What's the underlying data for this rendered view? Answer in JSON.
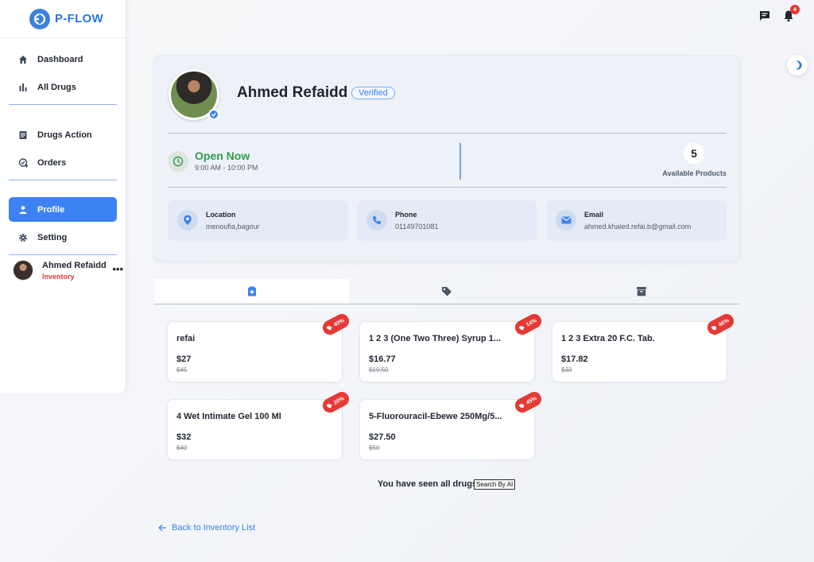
{
  "brand": {
    "name": "P-FLOW"
  },
  "sidebar": {
    "items": [
      {
        "label": "Dashboard",
        "icon": "home-icon"
      },
      {
        "label": "All Drugs",
        "icon": "bar-chart-icon"
      },
      {
        "label": "Drugs Action",
        "icon": "document-icon"
      },
      {
        "label": "Orders",
        "icon": "add-order-icon"
      },
      {
        "label": "Profile",
        "icon": "person-icon",
        "active": true
      },
      {
        "label": "Setting",
        "icon": "gear-icon"
      }
    ],
    "user": {
      "name": "Ahmed Refaidd",
      "role": "Inventory"
    }
  },
  "topbar": {
    "notification_count": "4"
  },
  "profile": {
    "name": "Ahmed Refaidd",
    "verified_label": "Verified",
    "status": "Open Now",
    "hours": "9:00 AM - 10:00 PM",
    "available_count": "5",
    "available_label": "Available Products",
    "location": {
      "title": "Location",
      "value": "menoufia,bagour"
    },
    "phone": {
      "title": "Phone",
      "value": "01149701081"
    },
    "email": {
      "title": "Email",
      "value": "ahmed.khaled.refai.b@gmail.com"
    }
  },
  "tabs": [
    {
      "icon": "medical-box-icon",
      "active": true
    },
    {
      "icon": "tag-icon"
    },
    {
      "icon": "archive-icon"
    }
  ],
  "products": [
    {
      "name": "refai",
      "price": "$27",
      "old_price": "$45",
      "discount": "40%"
    },
    {
      "name": "1 2 3 (One Two Three) Syrup 1...",
      "price": "$16.77",
      "old_price": "$19.50",
      "discount": "14%"
    },
    {
      "name": "1 2 3 Extra 20 F.C. Tab.",
      "price": "$17.82",
      "old_price": "$33",
      "discount": "46%"
    },
    {
      "name": "4 Wet Intimate Gel 100 Ml",
      "price": "$32",
      "old_price": "$40",
      "discount": "20%"
    },
    {
      "name": "5-Fluorouracil-Ebewe 250Mg/5...",
      "price": "$27.50",
      "old_price": "$50",
      "discount": "45%"
    }
  ],
  "footer": {
    "seen_all": "You have seen all drugs",
    "search_ai": "Search By AI",
    "back_link": "Back to Inventory List"
  },
  "colors": {
    "accent": "#3d82f2",
    "success": "#2e9d4c",
    "danger": "#e53935"
  }
}
